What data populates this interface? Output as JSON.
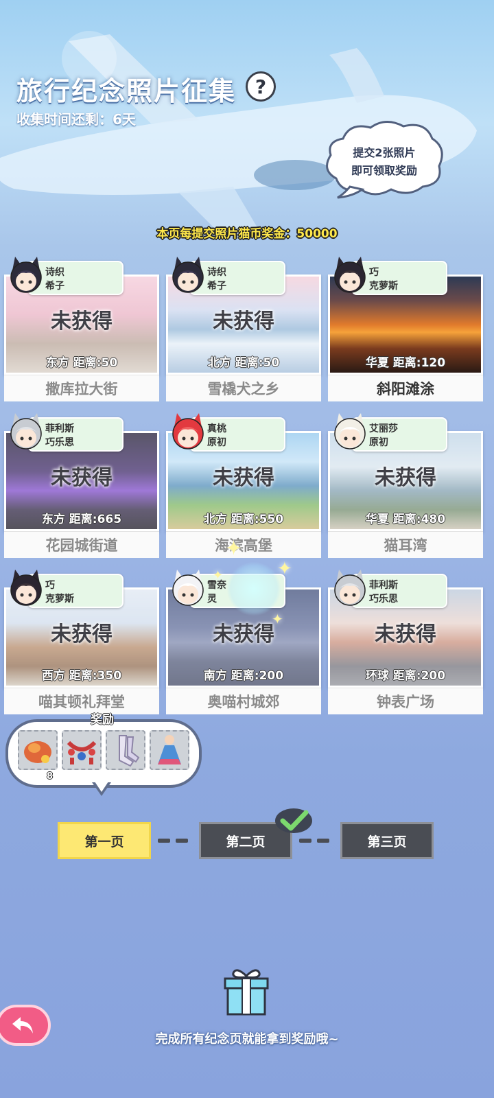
{
  "header": {
    "title": "旅行纪念照片征集",
    "help_icon": "?",
    "time_left": "收集时间还剩：6天",
    "bubble_line1": "提交2张照片",
    "bubble_line2": "即可领取奖励",
    "bonus": "本页每提交照片猫币奖金：50000"
  },
  "cards": [
    {
      "tag1": "诗织",
      "tag2": "希子",
      "status": "未获得",
      "dist": "东方  距离:50",
      "name": "撒库拉大街",
      "photo": "cherry-street",
      "done": false
    },
    {
      "tag1": "诗织",
      "tag2": "希子",
      "status": "未获得",
      "dist": "北方  距离:50",
      "name": "雪橇犬之乡",
      "photo": "glacier",
      "done": false
    },
    {
      "tag1": "巧",
      "tag2": "克萝斯",
      "status": "",
      "dist": "华夏  距离:120",
      "name": "斜阳滩涂",
      "photo": "sunset",
      "done": true
    },
    {
      "tag1": "菲利斯",
      "tag2": "巧乐思",
      "status": "未获得",
      "dist": "东方  距离:665",
      "name": "花园城街道",
      "photo": "night-garden",
      "done": false
    },
    {
      "tag1": "真桃",
      "tag2": "原初",
      "status": "未获得",
      "dist": "北方  距离:550",
      "name": "海滨高堡",
      "photo": "coast",
      "done": false
    },
    {
      "tag1": "艾丽莎",
      "tag2": "原初",
      "status": "未获得",
      "dist": "华夏  距离:480",
      "name": "猫耳湾",
      "photo": "bay",
      "done": false
    },
    {
      "tag1": "巧",
      "tag2": "克萝斯",
      "status": "未获得",
      "dist": "西方  距离:350",
      "name": "喵其顿礼拜堂",
      "photo": "church",
      "done": false
    },
    {
      "tag1": "雪奈",
      "tag2": "灵",
      "status": "未获得",
      "dist": "南方  距离:200",
      "name": "奥喵村城郊",
      "photo": "bridge",
      "done": false
    },
    {
      "tag1": "菲利斯",
      "tag2": "巧乐思",
      "status": "未获得",
      "dist": "环球  距离:200",
      "name": "钟表广场",
      "photo": "square",
      "done": false
    }
  ],
  "rewards": {
    "label": "奖励",
    "items": [
      {
        "icon": "fish-food-icon",
        "count": "8"
      },
      {
        "icon": "red-garland-icon",
        "count": ""
      },
      {
        "icon": "stockings-icon",
        "count": ""
      },
      {
        "icon": "dress-outfit-icon",
        "count": ""
      }
    ]
  },
  "pages": [
    {
      "label": "第一页",
      "state": "active"
    },
    {
      "label": "第二页",
      "state": "completed"
    },
    {
      "label": "第三页",
      "state": "inactive"
    }
  ],
  "footer": {
    "hint": "完成所有纪念页就能拿到奖励哦~"
  },
  "colors": {
    "active_tab": "#fde873",
    "inactive_tab": "#4a4d54",
    "tag_bg": "#e6f7e7",
    "back_button": "#f25c86",
    "bonus_text": "#ffe84a"
  }
}
